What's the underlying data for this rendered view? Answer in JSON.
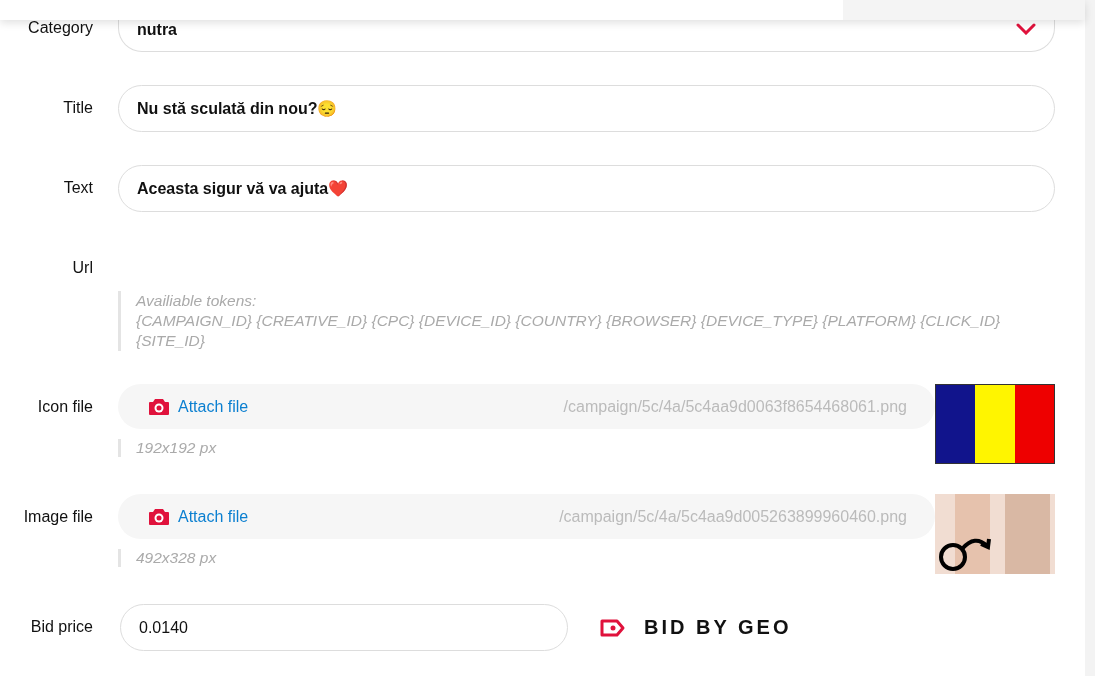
{
  "fields": [
    {
      "kind": "select",
      "label": "Category",
      "value": "nutra"
    },
    {
      "kind": "text",
      "label": "Title",
      "value": "Nu stă sculată din nou?😔"
    },
    {
      "kind": "text",
      "label": "Text",
      "value": "Aceasta sigur vă va ajuta❤️"
    },
    {
      "kind": "hint",
      "label": "Url",
      "hint_lines": [
        "Availiable tokens:",
        "{CAMPAIGN_ID} {CREATIVE_ID} {CPC} {DEVICE_ID} {COUNTRY} {BROWSER} {DEVICE_TYPE} {PLATFORM} {CLICK_ID}",
        "{SITE_ID}"
      ]
    },
    {
      "kind": "file",
      "label": "Icon file",
      "button": "Attach file",
      "path": "/campaign/5c/4a/5c4aa9d0063f8654468061.png",
      "size_hint": "192x192 px",
      "preview": {
        "kind": "flag"
      }
    },
    {
      "kind": "file",
      "label": "Image file",
      "button": "Attach file",
      "path": "/campaign/5c/4a/5c4aa9d005263899960460.png",
      "size_hint": "492x328 px",
      "preview": {
        "kind": "photo"
      }
    },
    {
      "kind": "bid",
      "label": "Bid price",
      "value": "0.0140",
      "link": "BID BY GEO"
    }
  ]
}
